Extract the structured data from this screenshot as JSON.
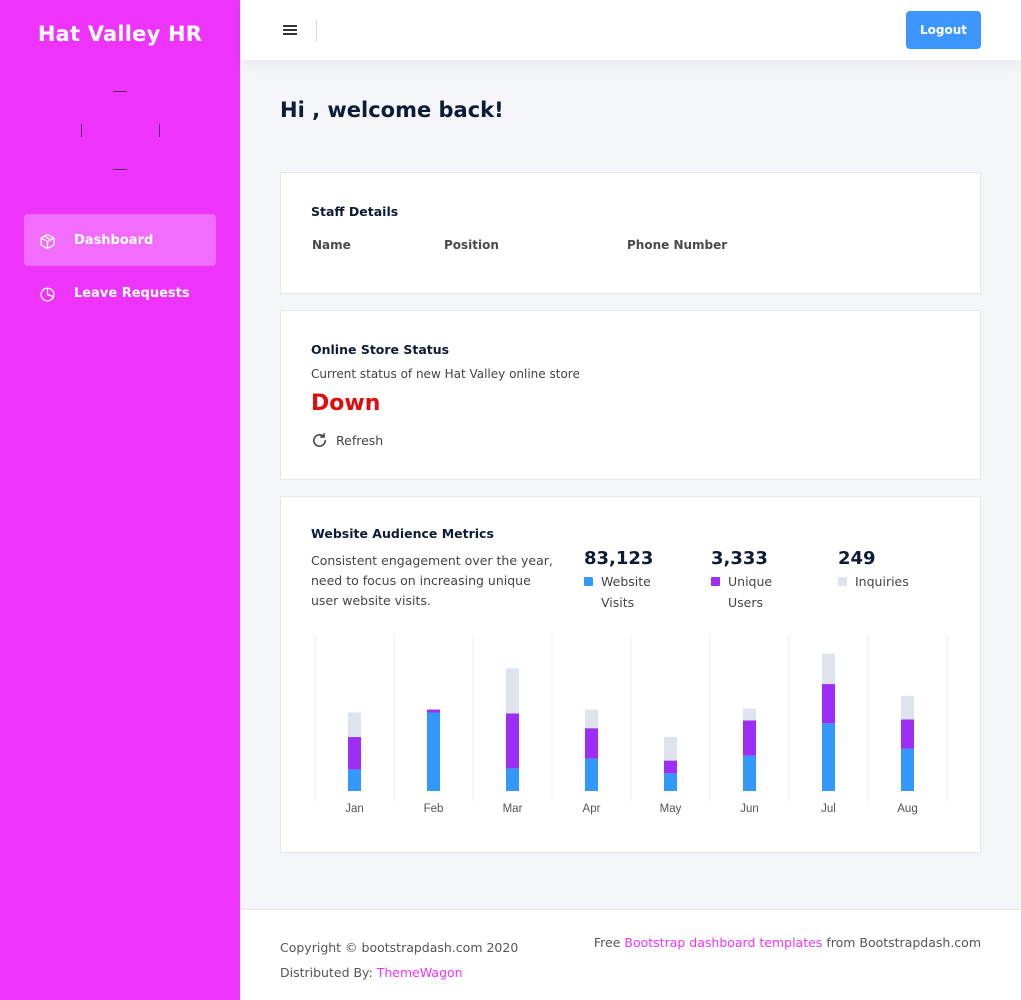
{
  "sidebar": {
    "brand": "Hat Valley HR",
    "items": [
      {
        "label": "Dashboard",
        "icon": "cube-icon",
        "active": true
      },
      {
        "label": "Leave Requests",
        "icon": "pie-chart-icon",
        "active": false
      }
    ]
  },
  "navbar": {
    "menu_icon": "hamburger-icon",
    "logout_label": "Logout"
  },
  "welcome": "Hi , welcome back!",
  "staff": {
    "title": "Staff Details",
    "columns": [
      "Name",
      "Position",
      "Phone Number"
    ]
  },
  "store": {
    "title": "Online Store Status",
    "subtitle": "Current status of new Hat Valley online store",
    "status": "Down",
    "refresh_label": "Refresh"
  },
  "metrics": {
    "title": "Website Audience Metrics",
    "description": "Consistent engagement over the year, need to focus on increasing unique user website visits.",
    "stats": [
      {
        "value": "83,123",
        "label": "Website Visits",
        "color": "#3398fb"
      },
      {
        "value": "3,333",
        "label": "Unique Users",
        "color": "#9d2ef6"
      },
      {
        "value": "249",
        "label": "Inquiries",
        "color": "#dee4ec"
      }
    ]
  },
  "chart_data": {
    "type": "bar",
    "stacked": true,
    "categories": [
      "Jan",
      "Feb",
      "Mar",
      "Apr",
      "May",
      "Jun",
      "Jul",
      "Aug"
    ],
    "series": [
      {
        "name": "Website Visits",
        "color": "#3398fb",
        "values": [
          22,
          80,
          23,
          33,
          18,
          36,
          69,
          43
        ]
      },
      {
        "name": "Unique Users",
        "color": "#9d2ef6",
        "values": [
          33,
          3,
          56,
          31,
          13,
          36,
          40,
          30
        ]
      },
      {
        "name": "Inquiries",
        "color": "#dee4ec",
        "values": [
          25,
          0,
          46,
          19,
          24,
          12,
          31,
          24
        ]
      }
    ],
    "ylim": [
      0,
      160
    ],
    "grid": "vertical"
  },
  "footer": {
    "copyright": "Copyright © bootstrapdash.com 2020",
    "distributed_prefix": "Distributed By:",
    "distributed_link": "ThemeWagon",
    "free_prefix": "Free",
    "free_link": "Bootstrap dashboard templates",
    "free_suffix": "from Bootstrapdash.com"
  }
}
